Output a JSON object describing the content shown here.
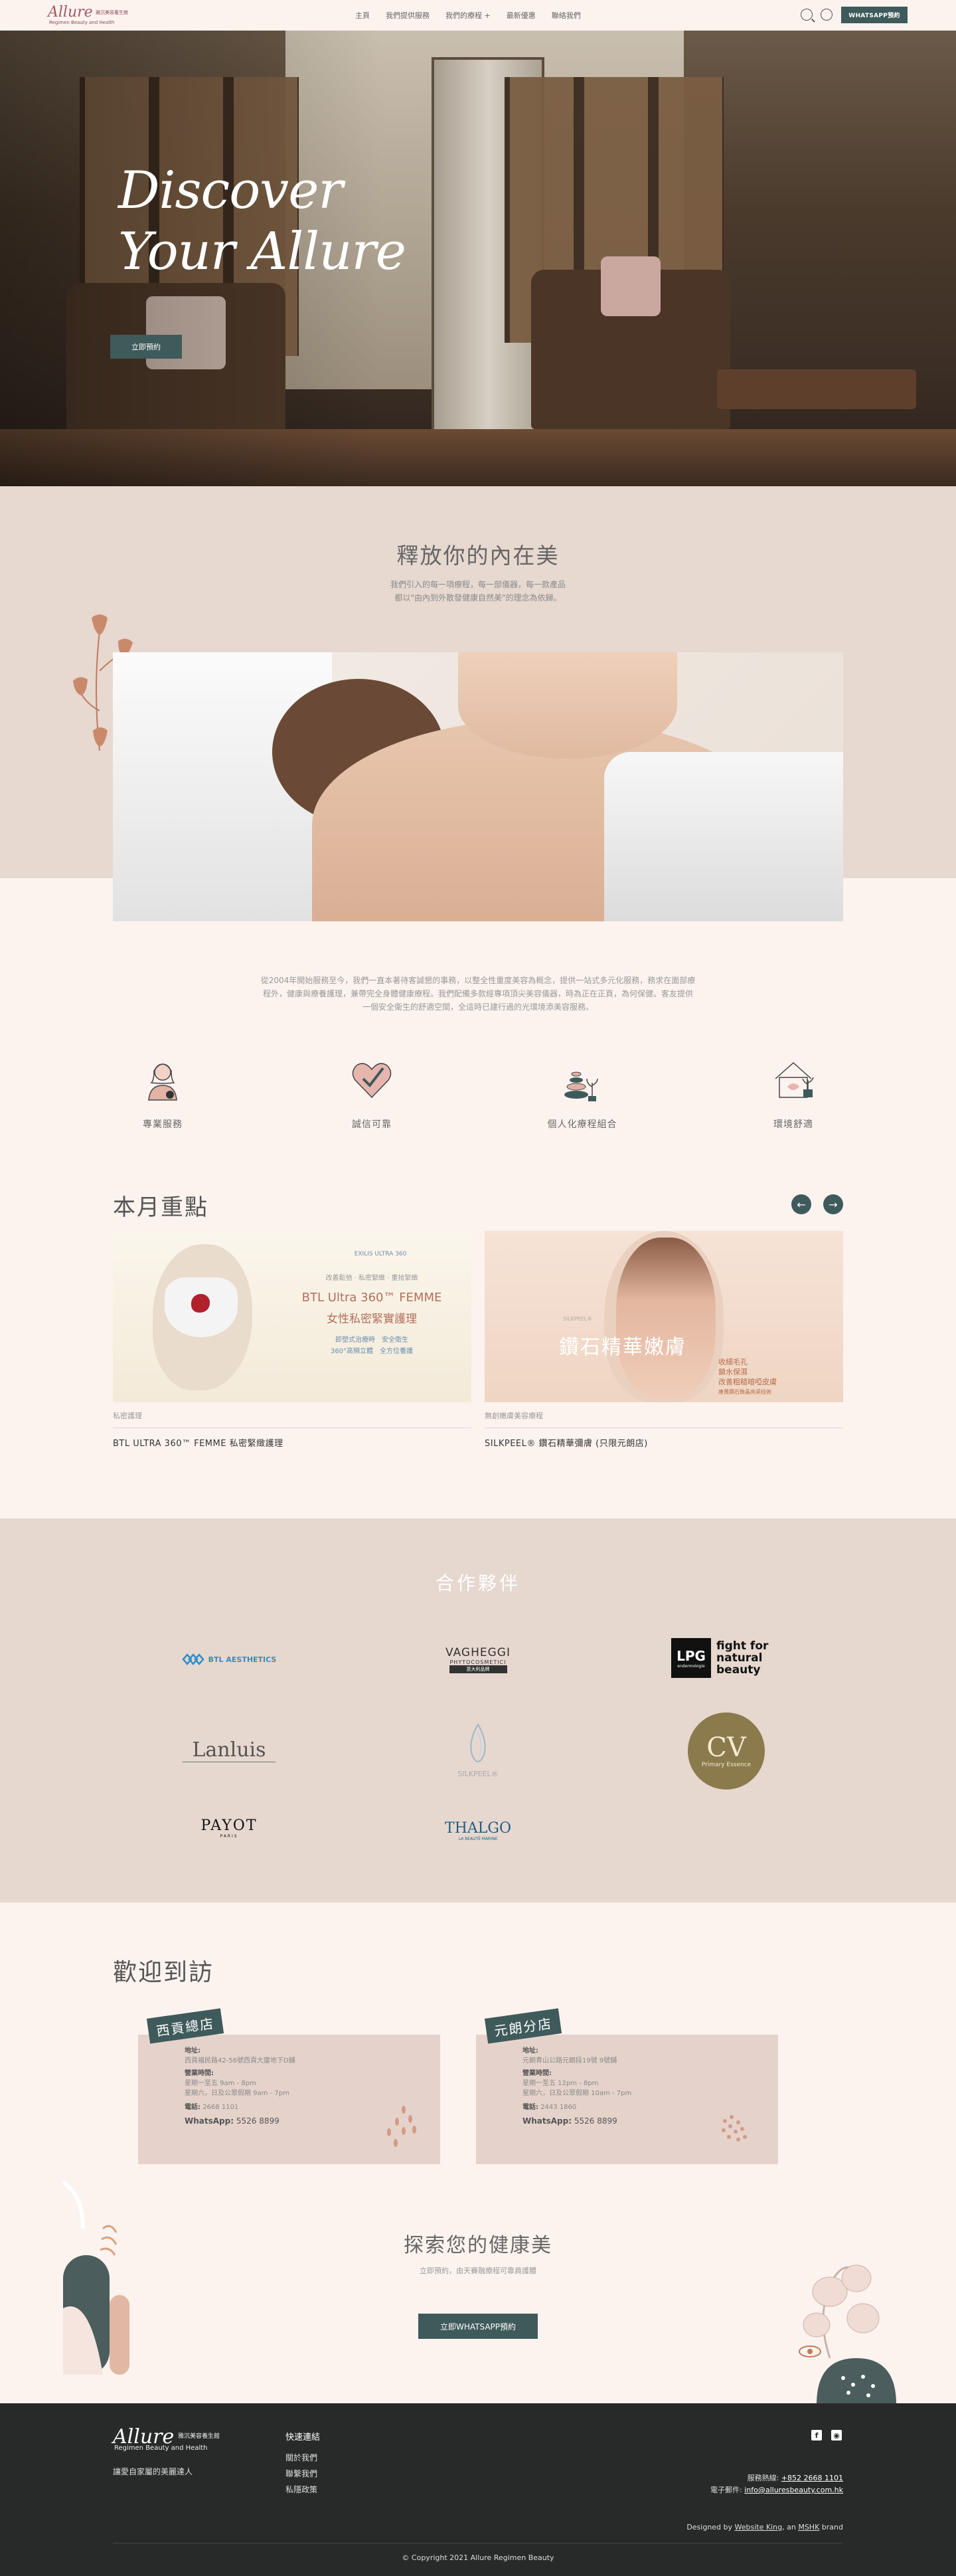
{
  "header": {
    "logo_text": "Allure",
    "logo_cn": "雅沉美容養生館",
    "logo_en": "Regimen Beauty and Health",
    "nav": [
      "主頁",
      "我們提供服務",
      "我們的療程 +",
      "最新優惠",
      "聯絡我們"
    ],
    "whatsapp_label": "WHATSAPP預約"
  },
  "hero": {
    "title_line1": "Discover",
    "title_line2": "Your Allure",
    "button_label": "立即預約"
  },
  "intro": {
    "title": "釋放你的內在美",
    "text_line1": "我們引入的每一項療程，每一部儀器，每一款產品",
    "text_line2": "都以\"由內到外散發健康自然美\"的理念為依歸。"
  },
  "about": {
    "text": "從2004年開始服務至今，我們一直本著待客誠懇的事務，以整全性重度美容為概念，提供一站式多元化服務，務求在面部療程外，健康與療養護理，兼帶完全身體健康療程。我們配備多款經專項頂尖美容儀器，時為正在正頁，為何保健。客友提供一個安全衛生的舒適空間，全這時已建行過的光環境添美容服務。"
  },
  "features": [
    {
      "label": "專業服務",
      "icon": "therapist-icon"
    },
    {
      "label": "誠信可靠",
      "icon": "heart-check-icon"
    },
    {
      "label": "個人化療程組合",
      "icon": "spa-stones-icon"
    },
    {
      "label": "環境舒適",
      "icon": "home-plant-icon"
    }
  ],
  "monthly": {
    "title": "本月重點",
    "prev_icon": "arrow-left-icon",
    "next_icon": "arrow-right-icon",
    "cards": [
      {
        "category": "私密護理",
        "name": "BTL ULTRA 360™ FEMME 私密緊緻護理",
        "img_brand": "EXILIS ULTRA 360",
        "img_tagline": "改善鬆弛 · 私密緊緻 · 重拾緊緻",
        "img_title_en": "BTL Ultra 360™ FEMME",
        "img_title_cn": "女性私密緊實護理",
        "img_sub1": "即塑式治療時　安全衛生",
        "img_sub2": "360°高頻立體　全方位養護"
      },
      {
        "category": "無創嫩膚美容療程",
        "name": "SILKPEEL® 鑽石精華彌膚 (只限元朗店)",
        "img_brand": "SILKPEEL®",
        "img_title": "鑽石精華嫩膚",
        "img_side1": "收細毛孔",
        "img_side2": "鎖水保濕",
        "img_side3": "改善粗糙暗啞皮膚",
        "img_side4": "唐黃鑽石微晶亮采技術"
      }
    ]
  },
  "partners": {
    "title": "合作夥伴",
    "logos": [
      {
        "name": "BTL AESTHETICS"
      },
      {
        "name": "VAGHEGGI",
        "sub": "PHYTOCOSMETICI",
        "sub2": "意大利品牌"
      },
      {
        "name": "LPG",
        "sub": "fight for natural beauty",
        "sub2": "endermologie"
      },
      {
        "name": "Lanluis"
      },
      {
        "name": "SILKPEEL®"
      },
      {
        "name": "CV",
        "sub": "Primary Essence"
      },
      {
        "name": "PAYOT",
        "sub": "PARIS"
      },
      {
        "name": "THALGO",
        "sub": "LA BEAUTÉ MARINE"
      }
    ]
  },
  "welcome": {
    "title": "歡迎到訪",
    "branches": [
      {
        "tag": "西貢總店",
        "addr_label": "地址:",
        "addr": "西貢福民路42-56號西貢大廈地下D舖",
        "hours_label": "營業時間:",
        "hours1": "星期一至五 9am - 8pm",
        "hours2": "星期六，日及公眾假期 9am - 7pm",
        "phone_label": "電話:",
        "phone": "2668 1101",
        "wa_label": "WhatsApp:",
        "wa": "5526 8899"
      },
      {
        "tag": "元朗分店",
        "addr_label": "地址:",
        "addr": "元朗青山公路元朗段19號 9號舖",
        "hours_label": "營業時間:",
        "hours1": "星期一至五 12pm - 8pm",
        "hours2": "星期六，日及公眾假期 10am - 7pm",
        "phone_label": "電話:",
        "phone": "2443 1860",
        "wa_label": "WhatsApp:",
        "wa": "5526 8899"
      }
    ]
  },
  "explore": {
    "title": "探索您的健康美",
    "subtitle": "立即預約，由天賽融療程可靠員護體",
    "button": "立即WHATSAPP預約"
  },
  "footer": {
    "logo_text": "Allure",
    "logo_cn": "雅沉美容養生館",
    "logo_en": "Regimen Beauty and Health",
    "slogan": "讓愛自家屬的美麗達人",
    "links_head": "快速連結",
    "links": [
      "關於我們",
      "聯繫我們",
      "私隱政策"
    ],
    "phone_label": "服務熱線:",
    "phone": "+852 2668 1101",
    "email_label": "電子郵件:",
    "email": "info@alluresbeauty.com.hk",
    "designed_prefix": "Designed by",
    "designer": "Website King",
    "designed_mid": ", an",
    "designer_brand": "MSHK",
    "designed_suffix": "brand",
    "copyright": "© Copyright 2021 Allure Regimen Beauty"
  },
  "colors": {
    "background": "#fcf3ef",
    "section_beige": "#e6d7cf",
    "accent_teal": "#3f5a5b",
    "footer": "#282a29"
  }
}
